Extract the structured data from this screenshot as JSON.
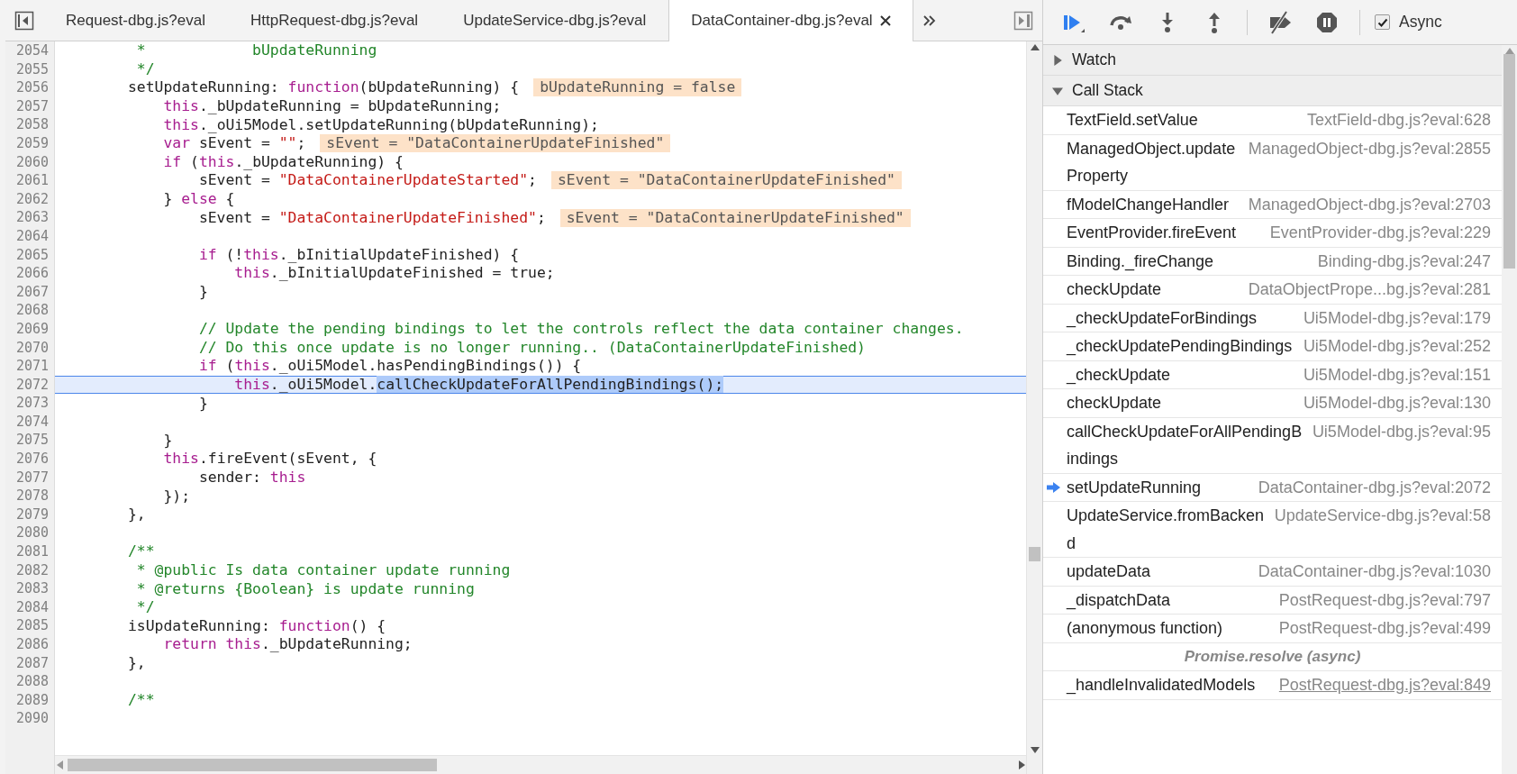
{
  "editor_tabs": [
    {
      "label": "Request-dbg.js?eval",
      "selected": false
    },
    {
      "label": "HttpRequest-dbg.js?eval",
      "selected": false
    },
    {
      "label": "UpdateService-dbg.js?eval",
      "selected": false
    },
    {
      "label": "DataContainer-dbg.js?eval",
      "selected": true
    }
  ],
  "code": {
    "lines": [
      {
        "number": "2054",
        "current": false,
        "tokens": [
          {
            "kind": "comment",
            "text": "         *            bUpdateRunning"
          }
        ]
      },
      {
        "number": "2055",
        "current": false,
        "tokens": [
          {
            "kind": "comment",
            "text": "         */"
          }
        ]
      },
      {
        "number": "2056",
        "current": false,
        "tokens": [
          {
            "kind": "plain",
            "text": "        setUpdateRunning: "
          },
          {
            "kind": "keyword",
            "text": "function"
          },
          {
            "kind": "plain",
            "text": "(bUpdateRunning) {"
          }
        ],
        "inline_value": "bUpdateRunning = false"
      },
      {
        "number": "2057",
        "current": false,
        "tokens": [
          {
            "kind": "keyword",
            "text": "            this"
          },
          {
            "kind": "plain",
            "text": "._bUpdateRunning = bUpdateRunning;"
          }
        ]
      },
      {
        "number": "2058",
        "current": false,
        "tokens": [
          {
            "kind": "keyword",
            "text": "            this"
          },
          {
            "kind": "plain",
            "text": "._oUi5Model.setUpdateRunning(bUpdateRunning);"
          }
        ]
      },
      {
        "number": "2059",
        "current": false,
        "tokens": [
          {
            "kind": "keyword",
            "text": "            var"
          },
          {
            "kind": "plain",
            "text": " sEvent = "
          },
          {
            "kind": "string",
            "text": "\"\""
          },
          {
            "kind": "plain",
            "text": ";"
          }
        ],
        "inline_value": "sEvent = \"DataContainerUpdateFinished\""
      },
      {
        "number": "2060",
        "current": false,
        "tokens": [
          {
            "kind": "keyword",
            "text": "            if"
          },
          {
            "kind": "plain",
            "text": " ("
          },
          {
            "kind": "keyword",
            "text": "this"
          },
          {
            "kind": "plain",
            "text": "._bUpdateRunning) {"
          }
        ]
      },
      {
        "number": "2061",
        "current": false,
        "tokens": [
          {
            "kind": "plain",
            "text": "                sEvent = "
          },
          {
            "kind": "string",
            "text": "\"DataContainerUpdateStarted\""
          },
          {
            "kind": "plain",
            "text": ";"
          }
        ],
        "inline_value": "sEvent = \"DataContainerUpdateFinished\""
      },
      {
        "number": "2062",
        "current": false,
        "tokens": [
          {
            "kind": "plain",
            "text": "            } "
          },
          {
            "kind": "keyword",
            "text": "else"
          },
          {
            "kind": "plain",
            "text": " {"
          }
        ]
      },
      {
        "number": "2063",
        "current": false,
        "tokens": [
          {
            "kind": "plain",
            "text": "                sEvent = "
          },
          {
            "kind": "string",
            "text": "\"DataContainerUpdateFinished\""
          },
          {
            "kind": "plain",
            "text": ";"
          }
        ],
        "inline_value": "sEvent = \"DataContainerUpdateFinished\""
      },
      {
        "number": "2064",
        "current": false
      },
      {
        "number": "2065",
        "current": false,
        "tokens": [
          {
            "kind": "keyword",
            "text": "                if"
          },
          {
            "kind": "plain",
            "text": " (!"
          },
          {
            "kind": "keyword",
            "text": "this"
          },
          {
            "kind": "plain",
            "text": "._bInitialUpdateFinished) {"
          }
        ]
      },
      {
        "number": "2066",
        "current": false,
        "tokens": [
          {
            "kind": "keyword",
            "text": "                    this"
          },
          {
            "kind": "plain",
            "text": "._bInitialUpdateFinished = true;"
          }
        ]
      },
      {
        "number": "2067",
        "current": false,
        "tokens": [
          {
            "kind": "plain",
            "text": "                }"
          }
        ]
      },
      {
        "number": "2068",
        "current": false
      },
      {
        "number": "2069",
        "current": false,
        "tokens": [
          {
            "kind": "comment",
            "text": "                // Update the pending bindings to let the controls reflect the data container changes."
          }
        ]
      },
      {
        "number": "2070",
        "current": false,
        "tokens": [
          {
            "kind": "comment",
            "text": "                // Do this once update is no longer running.. (DataContainerUpdateFinished)"
          }
        ]
      },
      {
        "number": "2071",
        "current": false,
        "tokens": [
          {
            "kind": "keyword",
            "text": "                if"
          },
          {
            "kind": "plain",
            "text": " ("
          },
          {
            "kind": "keyword",
            "text": "this"
          },
          {
            "kind": "plain",
            "text": "._oUi5Model.hasPendingBindings()) {"
          }
        ]
      },
      {
        "number": "2072",
        "current": true,
        "tokens": [
          {
            "kind": "keyword",
            "text": "                    this"
          },
          {
            "kind": "plain",
            "text": "._oUi5Model."
          },
          {
            "kind": "selection",
            "text": "callCheckUpdateForAllPendingBindings();"
          }
        ]
      },
      {
        "number": "2073",
        "current": false,
        "tokens": [
          {
            "kind": "plain",
            "text": "                }"
          }
        ]
      },
      {
        "number": "2074",
        "current": false
      },
      {
        "number": "2075",
        "current": false,
        "tokens": [
          {
            "kind": "plain",
            "text": "            }"
          }
        ]
      },
      {
        "number": "2076",
        "current": false,
        "tokens": [
          {
            "kind": "keyword",
            "text": "            this"
          },
          {
            "kind": "plain",
            "text": ".fireEvent(sEvent, {"
          }
        ]
      },
      {
        "number": "2077",
        "current": false,
        "tokens": [
          {
            "kind": "plain",
            "text": "                sender: "
          },
          {
            "kind": "keyword",
            "text": "this"
          }
        ]
      },
      {
        "number": "2078",
        "current": false,
        "tokens": [
          {
            "kind": "plain",
            "text": "            });"
          }
        ]
      },
      {
        "number": "2079",
        "current": false,
        "tokens": [
          {
            "kind": "plain",
            "text": "        },"
          }
        ]
      },
      {
        "number": "2080",
        "current": false
      },
      {
        "number": "2081",
        "current": false,
        "tokens": [
          {
            "kind": "comment",
            "text": "        /**"
          }
        ]
      },
      {
        "number": "2082",
        "current": false,
        "tokens": [
          {
            "kind": "comment",
            "text": "         * @public Is data container update running"
          }
        ]
      },
      {
        "number": "2083",
        "current": false,
        "tokens": [
          {
            "kind": "comment",
            "text": "         * @returns {Boolean} is update running"
          }
        ]
      },
      {
        "number": "2084",
        "current": false,
        "tokens": [
          {
            "kind": "comment",
            "text": "         */"
          }
        ]
      },
      {
        "number": "2085",
        "current": false,
        "tokens": [
          {
            "kind": "plain",
            "text": "        isUpdateRunning: "
          },
          {
            "kind": "keyword",
            "text": "function"
          },
          {
            "kind": "plain",
            "text": "() {"
          }
        ]
      },
      {
        "number": "2086",
        "current": false,
        "tokens": [
          {
            "kind": "keyword",
            "text": "            return this"
          },
          {
            "kind": "plain",
            "text": "._bUpdateRunning;"
          }
        ]
      },
      {
        "number": "2087",
        "current": false,
        "tokens": [
          {
            "kind": "plain",
            "text": "        },"
          }
        ]
      },
      {
        "number": "2088",
        "current": false
      },
      {
        "number": "2089",
        "current": false,
        "tokens": [
          {
            "kind": "comment",
            "text": "        /**"
          }
        ]
      },
      {
        "number": "2090",
        "current": false
      }
    ]
  },
  "debugger": {
    "async": {
      "label": "Async",
      "checked": true
    },
    "watch": {
      "label": "Watch",
      "expanded": false
    },
    "call_stack": {
      "label": "Call Stack",
      "expanded": true,
      "items": [
        {
          "kind": "frame",
          "function": "TextField.setValue",
          "location": "TextField-dbg.js?eval:628",
          "current": false,
          "hovered": false
        },
        {
          "kind": "frame",
          "function": "ManagedObject.updateProperty",
          "location": "ManagedObject-dbg.js?eval:2855",
          "current": false,
          "hovered": false
        },
        {
          "kind": "frame",
          "function": "fModelChangeHandler",
          "location": "ManagedObject-dbg.js?eval:2703",
          "current": false,
          "hovered": false
        },
        {
          "kind": "frame",
          "function": "EventProvider.fireEvent",
          "location": "EventProvider-dbg.js?eval:229",
          "current": false,
          "hovered": false
        },
        {
          "kind": "frame",
          "function": "Binding._fireChange",
          "location": "Binding-dbg.js?eval:247",
          "current": false,
          "hovered": false
        },
        {
          "kind": "frame",
          "function": "checkUpdate",
          "location": "DataObjectPrope...bg.js?eval:281",
          "current": false,
          "hovered": false
        },
        {
          "kind": "frame",
          "function": "_checkUpdateForBindings",
          "location": "Ui5Model-dbg.js?eval:179",
          "current": false,
          "hovered": false
        },
        {
          "kind": "frame",
          "function": "_checkUpdatePendingBindings",
          "location": "Ui5Model-dbg.js?eval:252",
          "current": false,
          "hovered": false
        },
        {
          "kind": "frame",
          "function": "_checkUpdate",
          "location": "Ui5Model-dbg.js?eval:151",
          "current": false,
          "hovered": false
        },
        {
          "kind": "frame",
          "function": "checkUpdate",
          "location": "Ui5Model-dbg.js?eval:130",
          "current": false,
          "hovered": false
        },
        {
          "kind": "frame",
          "function": "callCheckUpdateForAllPendingBindings",
          "location": "Ui5Model-dbg.js?eval:95",
          "current": false,
          "hovered": false
        },
        {
          "kind": "frame",
          "function": "setUpdateRunning",
          "location": "DataContainer-dbg.js?eval:2072",
          "current": true,
          "hovered": false
        },
        {
          "kind": "frame",
          "function": "UpdateService.fromBackend",
          "location": "UpdateService-dbg.js?eval:58",
          "current": false,
          "hovered": false
        },
        {
          "kind": "frame",
          "function": "updateData",
          "location": "DataContainer-dbg.js?eval:1030",
          "current": false,
          "hovered": false
        },
        {
          "kind": "frame",
          "function": "_dispatchData",
          "location": "PostRequest-dbg.js?eval:797",
          "current": false,
          "hovered": false
        },
        {
          "kind": "frame",
          "function": "(anonymous function)",
          "location": "PostRequest-dbg.js?eval:499",
          "current": false,
          "hovered": false
        },
        {
          "kind": "async",
          "label": "Promise.resolve (async)"
        },
        {
          "kind": "frame",
          "function": "_handleInvalidatedModels",
          "location": "PostRequest-dbg.js?eval:849",
          "current": false,
          "hovered": true
        }
      ]
    }
  }
}
